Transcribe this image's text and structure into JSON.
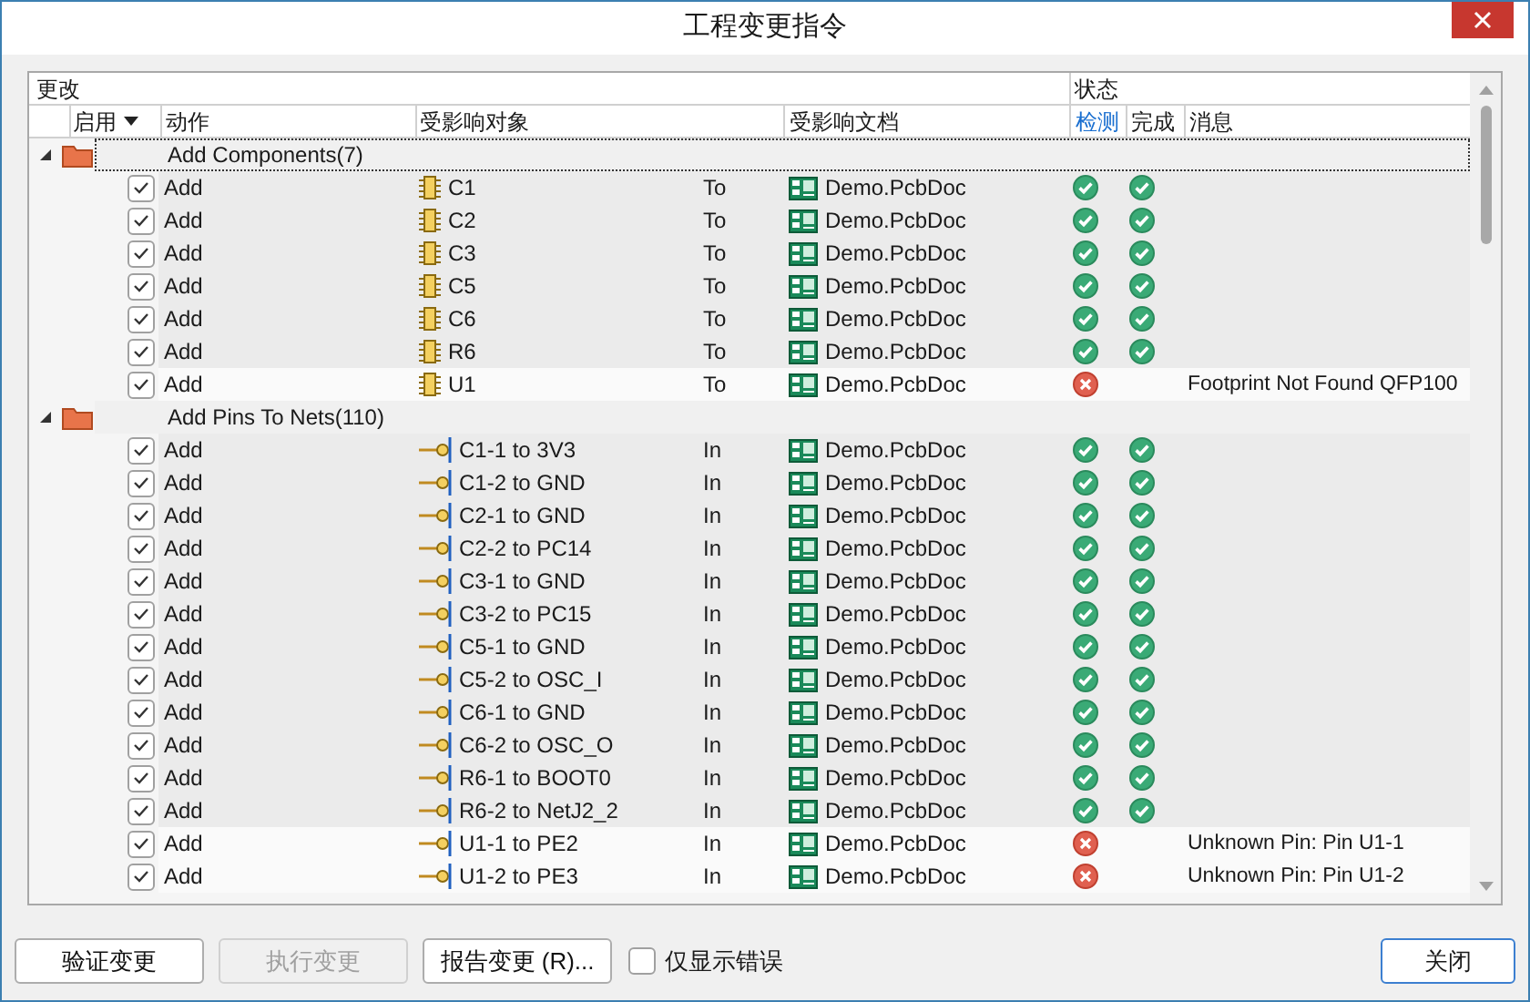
{
  "window": {
    "title": "工程变更指令"
  },
  "header_groups": [
    {
      "label": "更改"
    },
    {
      "label": "状态"
    }
  ],
  "columns": [
    {
      "label": "启用",
      "sorted": true,
      "highlighted": false
    },
    {
      "label": "动作",
      "sorted": false,
      "highlighted": false
    },
    {
      "label": "受影响对象",
      "sorted": false,
      "highlighted": false
    },
    {
      "label": "受影响文档",
      "sorted": false,
      "highlighted": false
    },
    {
      "label": "检测",
      "sorted": false,
      "highlighted": true
    },
    {
      "label": "完成",
      "sorted": false,
      "highlighted": false
    },
    {
      "label": "消息",
      "sorted": false,
      "highlighted": false
    }
  ],
  "groups": [
    {
      "title": "Add Components(7)",
      "expanded": true,
      "selected": true,
      "items": [
        {
          "enabled": true,
          "action": "Add",
          "kind": "component",
          "object": "C1",
          "direction": "To",
          "document": "Demo.PcbDoc",
          "check_passed": true,
          "done": true
        },
        {
          "enabled": true,
          "action": "Add",
          "kind": "component",
          "object": "C2",
          "direction": "To",
          "document": "Demo.PcbDoc",
          "check_passed": true,
          "done": true
        },
        {
          "enabled": true,
          "action": "Add",
          "kind": "component",
          "object": "C3",
          "direction": "To",
          "document": "Demo.PcbDoc",
          "check_passed": true,
          "done": true
        },
        {
          "enabled": true,
          "action": "Add",
          "kind": "component",
          "object": "C5",
          "direction": "To",
          "document": "Demo.PcbDoc",
          "check_passed": true,
          "done": true
        },
        {
          "enabled": true,
          "action": "Add",
          "kind": "component",
          "object": "C6",
          "direction": "To",
          "document": "Demo.PcbDoc",
          "check_passed": true,
          "done": true
        },
        {
          "enabled": true,
          "action": "Add",
          "kind": "component",
          "object": "R6",
          "direction": "To",
          "document": "Demo.PcbDoc",
          "check_passed": true,
          "done": true
        },
        {
          "enabled": true,
          "action": "Add",
          "kind": "component",
          "object": "U1",
          "direction": "To",
          "document": "Demo.PcbDoc",
          "check_passed": false,
          "done": false,
          "message": "Footprint Not Found QFP100"
        }
      ]
    },
    {
      "title": "Add Pins To Nets(110)",
      "expanded": true,
      "selected": false,
      "items": [
        {
          "enabled": true,
          "action": "Add",
          "kind": "pin",
          "object": "C1-1 to 3V3",
          "direction": "In",
          "document": "Demo.PcbDoc",
          "check_passed": true,
          "done": true
        },
        {
          "enabled": true,
          "action": "Add",
          "kind": "pin",
          "object": "C1-2 to GND",
          "direction": "In",
          "document": "Demo.PcbDoc",
          "check_passed": true,
          "done": true
        },
        {
          "enabled": true,
          "action": "Add",
          "kind": "pin",
          "object": "C2-1 to GND",
          "direction": "In",
          "document": "Demo.PcbDoc",
          "check_passed": true,
          "done": true
        },
        {
          "enabled": true,
          "action": "Add",
          "kind": "pin",
          "object": "C2-2 to PC14",
          "direction": "In",
          "document": "Demo.PcbDoc",
          "check_passed": true,
          "done": true
        },
        {
          "enabled": true,
          "action": "Add",
          "kind": "pin",
          "object": "C3-1 to GND",
          "direction": "In",
          "document": "Demo.PcbDoc",
          "check_passed": true,
          "done": true
        },
        {
          "enabled": true,
          "action": "Add",
          "kind": "pin",
          "object": "C3-2 to PC15",
          "direction": "In",
          "document": "Demo.PcbDoc",
          "check_passed": true,
          "done": true
        },
        {
          "enabled": true,
          "action": "Add",
          "kind": "pin",
          "object": "C5-1 to GND",
          "direction": "In",
          "document": "Demo.PcbDoc",
          "check_passed": true,
          "done": true
        },
        {
          "enabled": true,
          "action": "Add",
          "kind": "pin",
          "object": "C5-2 to OSC_I",
          "direction": "In",
          "document": "Demo.PcbDoc",
          "check_passed": true,
          "done": true
        },
        {
          "enabled": true,
          "action": "Add",
          "kind": "pin",
          "object": "C6-1 to GND",
          "direction": "In",
          "document": "Demo.PcbDoc",
          "check_passed": true,
          "done": true
        },
        {
          "enabled": true,
          "action": "Add",
          "kind": "pin",
          "object": "C6-2 to OSC_O",
          "direction": "In",
          "document": "Demo.PcbDoc",
          "check_passed": true,
          "done": true
        },
        {
          "enabled": true,
          "action": "Add",
          "kind": "pin",
          "object": "R6-1 to BOOT0",
          "direction": "In",
          "document": "Demo.PcbDoc",
          "check_passed": true,
          "done": true
        },
        {
          "enabled": true,
          "action": "Add",
          "kind": "pin",
          "object": "R6-2 to NetJ2_2",
          "direction": "In",
          "document": "Demo.PcbDoc",
          "check_passed": true,
          "done": true
        },
        {
          "enabled": true,
          "action": "Add",
          "kind": "pin",
          "object": "U1-1 to PE2",
          "direction": "In",
          "document": "Demo.PcbDoc",
          "check_passed": false,
          "done": false,
          "message": "Unknown Pin: Pin U1-1"
        },
        {
          "enabled": true,
          "action": "Add",
          "kind": "pin",
          "object": "U1-2 to PE3",
          "direction": "In",
          "document": "Demo.PcbDoc",
          "check_passed": false,
          "done": false,
          "message": "Unknown Pin: Pin U1-2"
        }
      ]
    }
  ],
  "buttons": [
    {
      "label": "验证变更",
      "disabled": false,
      "default": false
    },
    {
      "label": "执行变更",
      "disabled": true,
      "default": false
    },
    {
      "label": "报告变更 (R)...",
      "disabled": false,
      "default": false
    }
  ],
  "only_errors": {
    "label": "仅显示错误",
    "checked": false
  },
  "close_button": {
    "label": "关闭",
    "default": true
  }
}
